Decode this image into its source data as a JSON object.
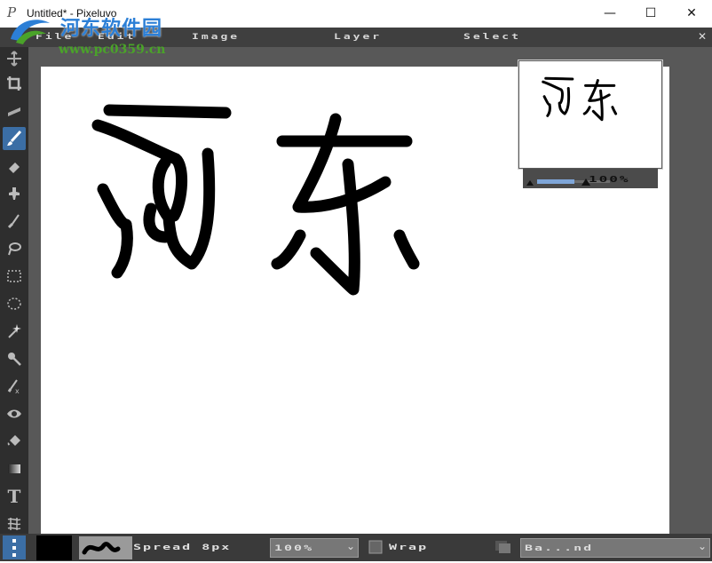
{
  "window": {
    "title": "Untitled* - Pixeluvo",
    "app_icon": "P",
    "minimize": "—",
    "maximize": "☐",
    "close": "✕"
  },
  "watermark": {
    "title": "河东软件园",
    "url": "www.pc0359.cn"
  },
  "menu": {
    "items": [
      "File",
      "Edit",
      "Image",
      "Layer",
      "Select"
    ],
    "close_glyph": "✕"
  },
  "toolbar": {
    "tools": [
      "move-icon",
      "crop-icon",
      "straighten-icon",
      "brush-icon",
      "eraser-icon",
      "clone-icon",
      "smudge-icon",
      "lasso-icon",
      "rect-select-icon",
      "ellipse-select-icon",
      "magic-wand-icon",
      "eyedropper-icon",
      "color-replace-icon",
      "red-eye-icon",
      "fill-icon",
      "gradient-icon",
      "text-icon",
      "warp-icon"
    ],
    "active_tool": "brush-icon",
    "text_tool_label": "T"
  },
  "canvas": {
    "text": "河东"
  },
  "navigator": {
    "zoom_label": "100%",
    "zoom_level": 0.4
  },
  "bottombar": {
    "brush_size_label": "Spread 8px",
    "opacity_value": "100%",
    "wrap_label": "Wrap",
    "blend_mode": "Ba...nd",
    "colors": {
      "foreground": "#000000"
    }
  }
}
